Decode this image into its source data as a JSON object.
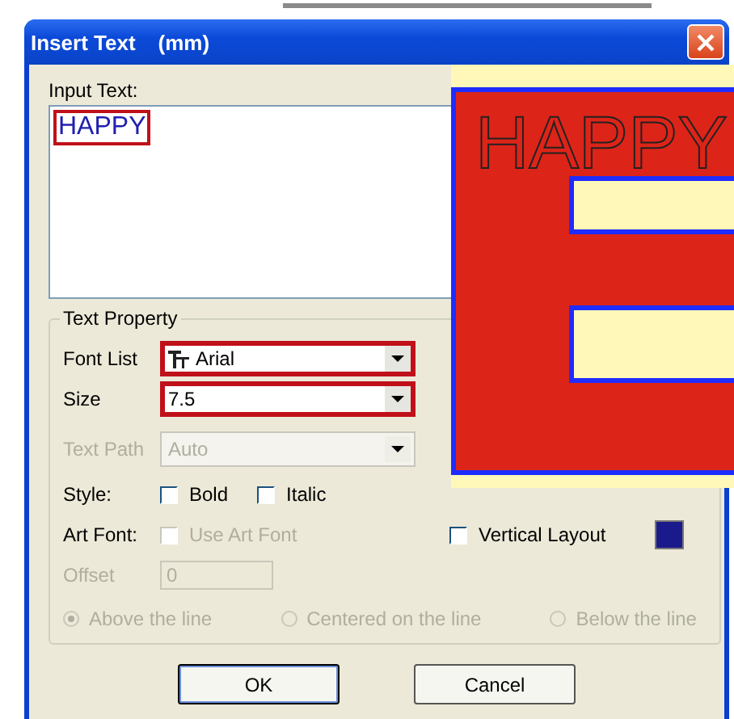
{
  "window": {
    "title": "Insert Text",
    "unit": "(mm)"
  },
  "input_text": {
    "label": "Input Text:",
    "value": "HAPPY",
    "highlighted": true
  },
  "text_property": {
    "title": "Text Property",
    "font_list": {
      "label": "Font List",
      "value": "Arial",
      "highlighted": true,
      "disabled": false
    },
    "size": {
      "label": "Size",
      "value": "7.5",
      "highlighted": true,
      "disabled": false
    },
    "text_path": {
      "label": "Text Path",
      "value": "Auto",
      "disabled": true
    },
    "style": {
      "label": "Style:",
      "options": [
        {
          "label": "Bold",
          "checked": false
        },
        {
          "label": "Italic",
          "checked": false
        }
      ]
    },
    "art_font": {
      "label": "Art Font:",
      "option": {
        "label": "Use Art Font",
        "checked": false,
        "disabled": true
      }
    },
    "vertical_layout": {
      "label": "Vertical Layout",
      "checked": false
    },
    "offset": {
      "label": "Offset",
      "value": "0",
      "disabled": true
    },
    "placement": [
      {
        "label": "Above the line",
        "selected": true,
        "disabled": true
      },
      {
        "label": "Centered on the line",
        "selected": false,
        "disabled": true
      },
      {
        "label": "Below the line",
        "selected": false,
        "disabled": true
      }
    ]
  },
  "preview": {
    "text": "HAPPY"
  },
  "buttons": [
    {
      "label": "OK",
      "default": true
    },
    {
      "label": "Cancel",
      "default": false
    }
  ]
}
